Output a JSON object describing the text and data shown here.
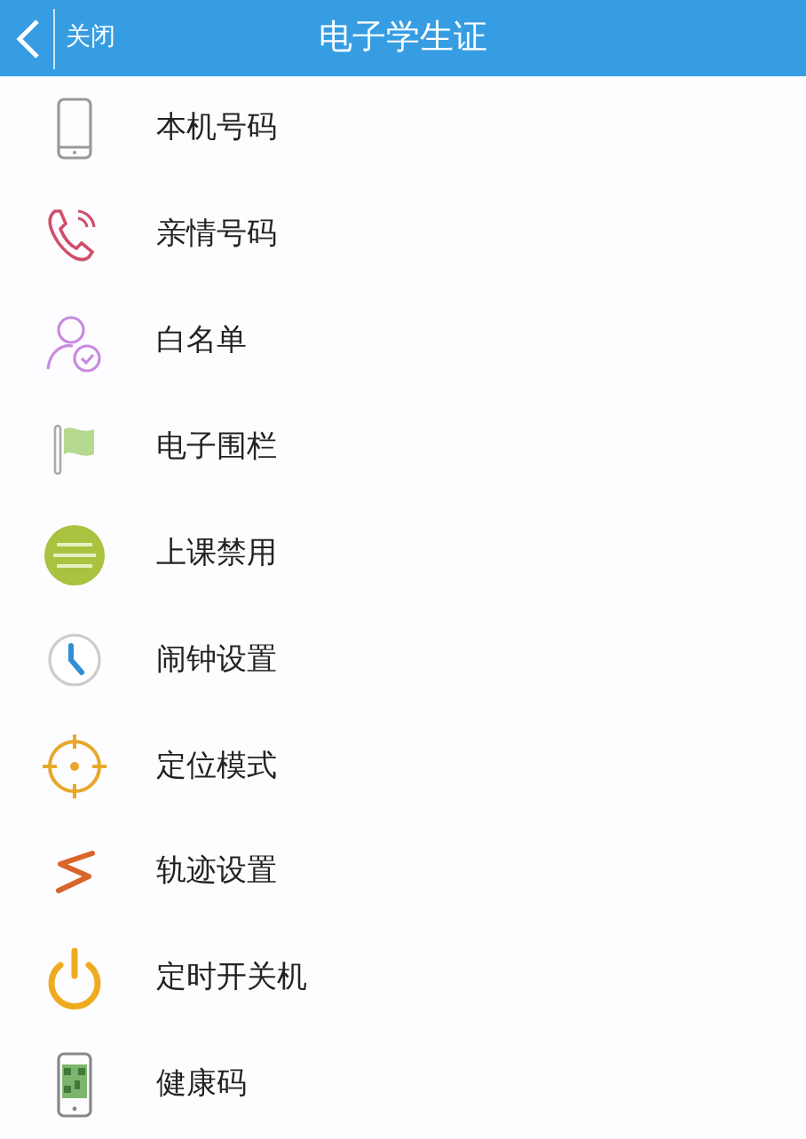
{
  "header": {
    "back_label": "关闭",
    "title": "电子学生证"
  },
  "items": [
    {
      "label": "本机号码",
      "kind": "phone"
    },
    {
      "label": "亲情号码",
      "kind": "call"
    },
    {
      "label": "白名单",
      "kind": "contact"
    },
    {
      "label": "电子围栏",
      "kind": "flag"
    },
    {
      "label": "上课禁用",
      "kind": "menu"
    },
    {
      "label": "闹钟设置",
      "kind": "clock"
    },
    {
      "label": "定位模式",
      "kind": "target"
    },
    {
      "label": "轨迹设置",
      "kind": "track"
    },
    {
      "label": "定时开关机",
      "kind": "power"
    },
    {
      "label": "健康码",
      "kind": "qr"
    }
  ]
}
